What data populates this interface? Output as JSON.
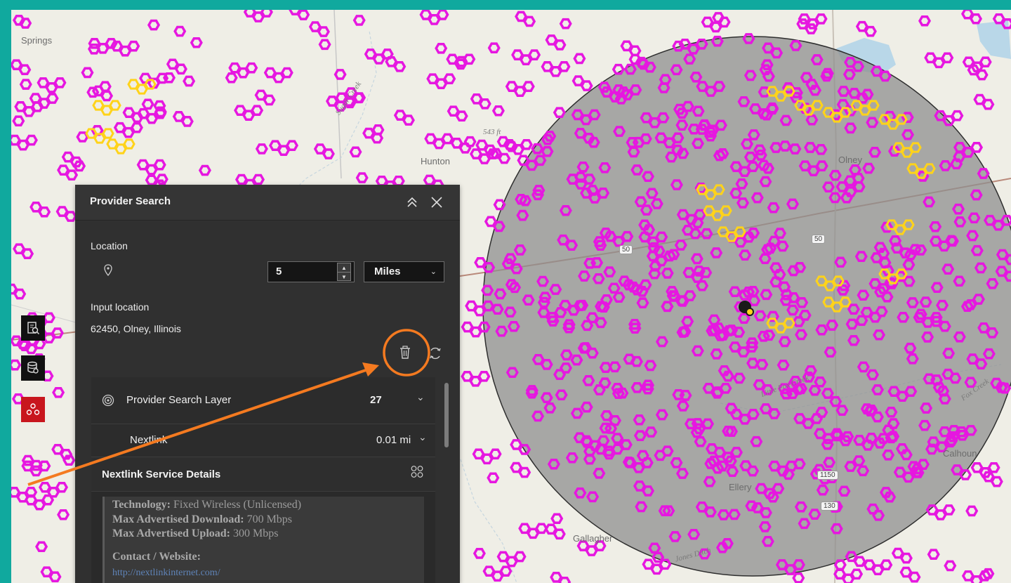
{
  "map": {
    "labels": {
      "town_springs": "Springs",
      "town_hunton": "Hunton",
      "town_olney": "Olney",
      "town_calhoun": "Calhoun",
      "town_gallagher": "Gallagher",
      "town_ellery": "Ellery",
      "creek_sugar": "Sugar Creek",
      "creek_little_fox": "Little Fox Creek",
      "creek_jones": "Jones Ditch",
      "creek_fox": "Fox Creek",
      "elevation": "543 ft"
    },
    "shields": [
      "50",
      "50",
      "1150",
      "130"
    ],
    "colors": {
      "coverage_primary": "#e617e0",
      "coverage_secondary": "#ffd31a",
      "search_buffer": "#8f8f8f",
      "frame": "#10a99e",
      "callout": "#f47a20"
    }
  },
  "toolbar": {
    "icons": [
      "search-document-icon",
      "database-search-icon",
      "provider-network-icon"
    ]
  },
  "panel": {
    "title": "Provider Search",
    "location_label": "Location",
    "distance_value": "5",
    "unit_value": "Miles",
    "input_location_label": "Input location",
    "input_location_value": "62450, Olney, Illinois",
    "results": {
      "layer_name": "Provider Search Layer",
      "layer_count": "27",
      "provider_name": "Nextlink",
      "provider_distance": "0.01 mi",
      "details_title": "Nextlink Service Details",
      "technology_label": "Technology:",
      "technology_value": "Fixed Wireless (Unlicensed)",
      "download_label": "Max Advertised Download:",
      "download_value": "700 Mbps",
      "upload_label": "Max Advertised Upload:",
      "upload_value": "300 Mbps",
      "contact_label": "Contact / Website:",
      "contact_value": "http://nextlinkinternet.com/"
    }
  }
}
